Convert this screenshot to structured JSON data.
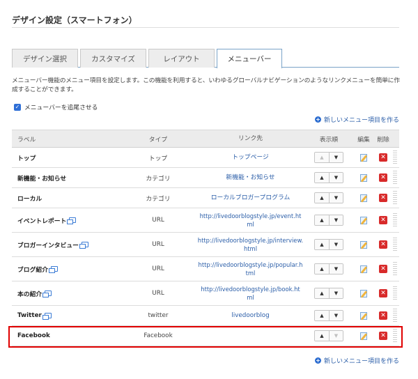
{
  "page": {
    "title": "デザイン設定（スマートフォン）"
  },
  "tabs": [
    {
      "label": "デザイン選択",
      "active": false
    },
    {
      "label": "カスタマイズ",
      "active": false
    },
    {
      "label": "レイアウト",
      "active": false
    },
    {
      "label": "メニューバー",
      "active": true
    }
  ],
  "description": "メニューバー機能のメニュー項目を設定します。この機能を利用すると、いわゆるグローバルナビゲーションのようなリンクメニューを簡単に作成することができます。",
  "follow_scroll": {
    "label": "メニューバーを追尾させる",
    "checked": true
  },
  "add_item_label": "新しいメニュー項目を作る",
  "table": {
    "headers": {
      "label": "ラベル",
      "type": "タイプ",
      "link": "リンク先",
      "order": "表示順",
      "edit": "編集",
      "delete": "削除"
    },
    "rows": [
      {
        "label": "トップ",
        "type": "トップ",
        "link": "トップページ",
        "external": false
      },
      {
        "label": "新機能・お知らせ",
        "type": "カテゴリ",
        "link": "新機能・お知らせ",
        "external": false
      },
      {
        "label": "ローカル",
        "type": "カテゴリ",
        "link": "ローカルブロガープログラム",
        "external": false
      },
      {
        "label": "イベントレポート",
        "type": "URL",
        "link": "http://livedoorblogstyle.jp/event.html",
        "link_l1": "http://livedoorblogstyle.jp/event.ht",
        "link_l2": "ml",
        "external": true
      },
      {
        "label": "ブロガーインタビュー",
        "type": "URL",
        "link": "http://livedoorblogstyle.jp/interview.html",
        "link_l1": "http://livedoorblogstyle.jp/interview.",
        "link_l2": "html",
        "external": true
      },
      {
        "label": "ブログ紹介",
        "type": "URL",
        "link": "http://livedoorblogstyle.jp/popular.html",
        "link_l1": "http://livedoorblogstyle.jp/popular.h",
        "link_l2": "tml",
        "external": true
      },
      {
        "label": "本の紹介",
        "type": "URL",
        "link": "http://livedoorblogstyle.jp/book.html",
        "link_l1": "http://livedoorblogstyle.jp/book.ht",
        "link_l2": "ml",
        "external": true
      },
      {
        "label": "Twitter",
        "type": "twitter",
        "link": "livedoorblog",
        "external": true
      },
      {
        "label": "Facebook",
        "type": "Facebook",
        "link": "",
        "external": false,
        "highlighted": true
      }
    ]
  },
  "colors": {
    "accent": "#2b5ea8",
    "highlight": "#e00000",
    "delete": "#d82a2a"
  },
  "icons": {
    "order_up": "▲",
    "order_down": "▼",
    "delete": "✕",
    "plus": "+",
    "check": "✓"
  }
}
